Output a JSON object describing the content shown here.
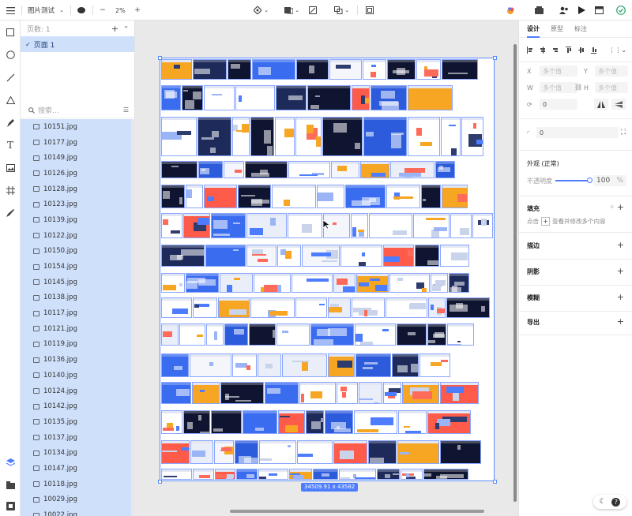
{
  "topbar": {
    "menu_icon": "hamburger-icon",
    "file_name": "图片测试",
    "zoom": "2%",
    "zoom_minus": "−",
    "zoom_plus": "+"
  },
  "pages": {
    "header": "页数: 1",
    "current_page": "页面 1",
    "search_placeholder": "搜索..."
  },
  "files": [
    "10151.jpg",
    "10177.jpg",
    "10149.jpg",
    "10126.jpg",
    "10128.jpg",
    "10123.jpg",
    "10139.jpg",
    "10122.jpg",
    "10150.jpg",
    "10154.jpg",
    "10145.jpg",
    "10138.jpg",
    "10117.jpg",
    "10121.jpg",
    "10119.jpg",
    "10136.jpg",
    "10140.jpg",
    "10124.jpg",
    "10142.jpg",
    "10135.jpg",
    "10137.jpg",
    "10134.jpg",
    "10147.jpg",
    "10118.jpg",
    "10029.jpg",
    "10022.jpg"
  ],
  "canvas": {
    "size_label": "34509.91 x 43582"
  },
  "inspector": {
    "tabs": [
      "设计",
      "原型",
      "标注"
    ],
    "x_label": "X",
    "y_label": "Y",
    "w_label": "W",
    "h_label": "H",
    "multi_value": "多个值",
    "rotation": "0",
    "radius": "0",
    "appearance": "外观 (正常)",
    "opacity_label": "不透明度",
    "opacity_value": "100",
    "opacity_unit": "%",
    "fill_title": "填充",
    "fill_hint": "点击",
    "fill_hint2": "查看并修改多个内容",
    "stroke_title": "描边",
    "shadow_title": "阴影",
    "blur_title": "模糊",
    "export_title": "导出"
  },
  "colors": {
    "accent": "#4d7cfe",
    "selection": "#cfe0fb"
  }
}
